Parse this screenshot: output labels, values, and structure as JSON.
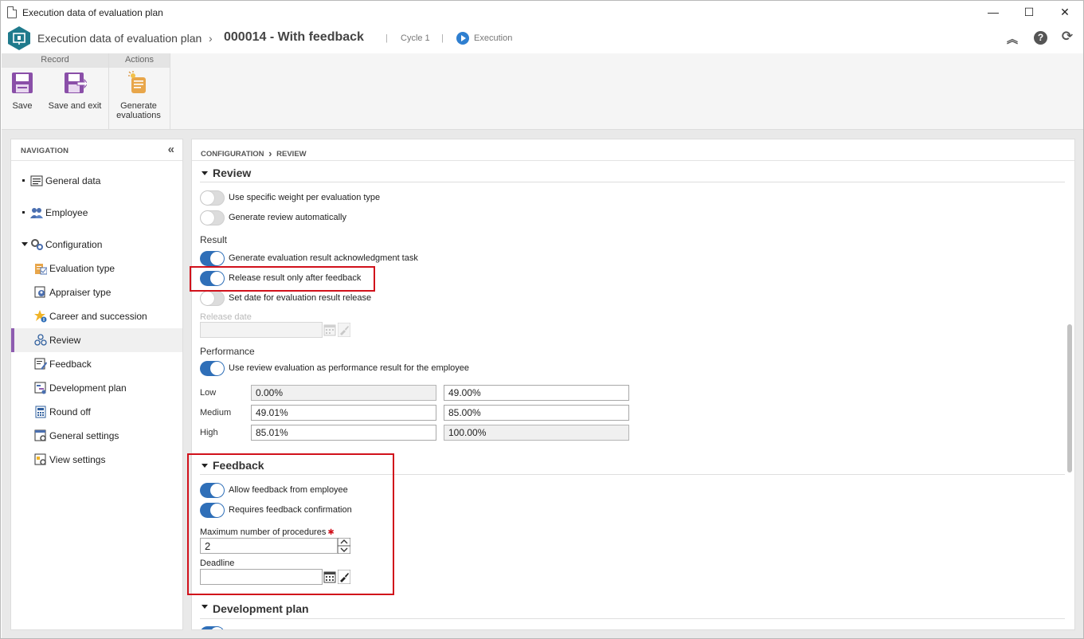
{
  "window": {
    "title": "Execution data of evaluation plan",
    "minimize": "—",
    "maximize": "☐",
    "close": "✕"
  },
  "header": {
    "breadcrumb_root": "Execution data of evaluation plan",
    "separator": "›",
    "record_title": "000014 - With feedback",
    "divider": "|",
    "cycle": "Cycle 1",
    "status": "Execution",
    "collapse_glyph": "︽",
    "help_glyph": "?",
    "refresh_glyph": "⟳",
    "accent_color": "#1f7a8c"
  },
  "ribbon": {
    "groups": [
      {
        "label": "Record"
      },
      {
        "label": "Actions"
      }
    ],
    "buttons": {
      "save": "Save",
      "save_exit": "Save and exit",
      "generate_line1": "Generate",
      "generate_line2": "evaluations"
    }
  },
  "navigation": {
    "header": "NAVIGATION",
    "collapse_glyph": "«",
    "items": [
      {
        "label": "General data",
        "icon": "form-icon"
      },
      {
        "label": "Employee",
        "icon": "users-icon"
      },
      {
        "label": "Configuration",
        "icon": "gears-icon"
      },
      {
        "label": "Evaluation type",
        "icon": "evaluation-type-icon"
      },
      {
        "label": "Appraiser type",
        "icon": "appraiser-icon"
      },
      {
        "label": "Career and succession",
        "icon": "star-icon"
      },
      {
        "label": "Review",
        "icon": "review-icon"
      },
      {
        "label": "Feedback",
        "icon": "feedback-icon"
      },
      {
        "label": "Development plan",
        "icon": "development-plan-icon"
      },
      {
        "label": "Round off",
        "icon": "calculator-icon"
      },
      {
        "label": "General settings",
        "icon": "settings-icon"
      },
      {
        "label": "View settings",
        "icon": "view-settings-icon"
      }
    ],
    "selected": "Review",
    "selected_color": "#8e5cb0"
  },
  "content": {
    "breadcrumb": [
      "CONFIGURATION",
      "REVIEW"
    ],
    "crumb_sep": "›",
    "review": {
      "title": "Review",
      "toggles": [
        {
          "label": "Use specific weight per evaluation type",
          "on": false
        },
        {
          "label": "Generate review automatically",
          "on": false
        }
      ],
      "result_label": "Result",
      "result_toggles": [
        {
          "label": "Generate evaluation result acknowledgment task",
          "on": true
        },
        {
          "label": "Release result only after feedback",
          "on": true
        },
        {
          "label": "Set date for evaluation result release",
          "on": false
        }
      ],
      "release_date_label": "Release date",
      "release_date_value": "",
      "performance_label": "Performance",
      "performance_toggle": {
        "label": "Use review evaluation as performance result for the employee",
        "on": true
      },
      "performance_rows": [
        {
          "label": "Low",
          "from": "0.00%",
          "to": "49.00%"
        },
        {
          "label": "Medium",
          "from": "49.01%",
          "to": "85.00%"
        },
        {
          "label": "High",
          "from": "85.01%",
          "to": "100.00%"
        }
      ]
    },
    "feedback": {
      "title": "Feedback",
      "toggles": [
        {
          "label": "Allow feedback from employee",
          "on": true
        },
        {
          "label": "Requires feedback confirmation",
          "on": true
        }
      ],
      "max_procedures_label": "Maximum number of procedures",
      "required_glyph": "✱",
      "max_procedures_value": "2",
      "deadline_label": "Deadline",
      "deadline_value": ""
    },
    "development_plan": {
      "title": "Development plan"
    }
  },
  "highlight_color": "#d1111b",
  "toggle_on_color": "#2f6fb8"
}
